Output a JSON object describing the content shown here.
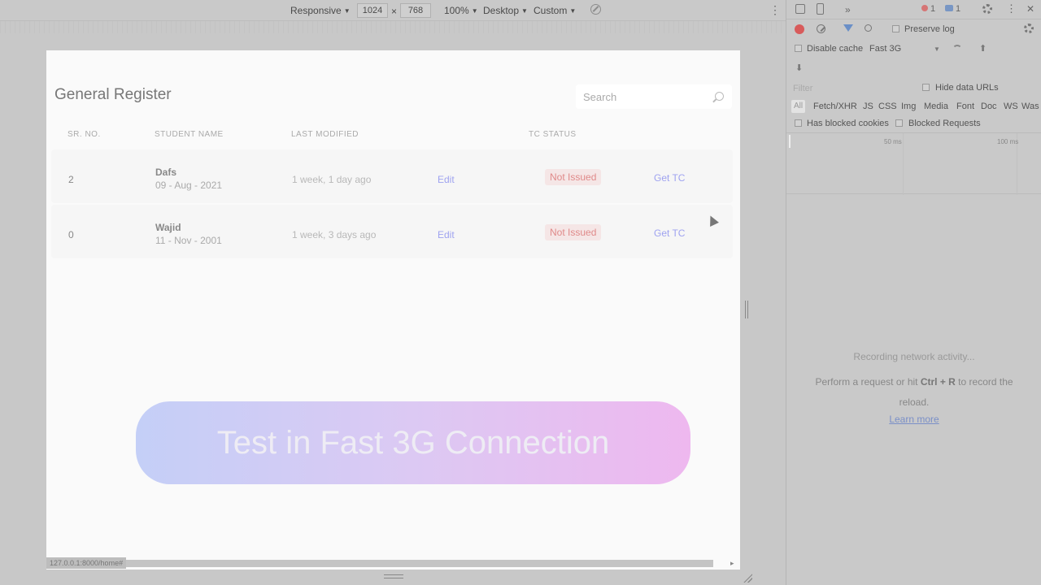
{
  "device_toolbar": {
    "dimensions": "Responsive",
    "width": "1024",
    "times": "×",
    "height": "768",
    "zoom": "100%",
    "device_type": "Desktop",
    "throttle": "Custom",
    "caret": "▼",
    "more": "⋮"
  },
  "page": {
    "title": "General Register",
    "search_placeholder": "Search",
    "columns": [
      "SR. NO.",
      "STUDENT NAME",
      "LAST MODIFIED",
      "TC STATUS"
    ],
    "rows": [
      {
        "sr": "2",
        "name": "Dafs",
        "dob": "09 - Aug - 2021",
        "modified": "1 week, 1 day ago",
        "edit": "Edit",
        "status": "Not Issued",
        "action": "Get TC"
      },
      {
        "sr": "0",
        "name": "Wajid",
        "dob": "11 - Nov - 2001",
        "modified": "1 week, 3 days ago",
        "edit": "Edit",
        "status": "Not Issued",
        "action": "Get TC"
      }
    ],
    "banner": "Test in Fast 3G Connection",
    "status_url": "127.0.0.1:8000/home#"
  },
  "devtools": {
    "more_tabs": "»",
    "error_count": "1",
    "message_count": "1",
    "close": "✕",
    "preserve_log": "Preserve log",
    "disable_cache": "Disable cache",
    "throttle": "Fast 3G",
    "import_icon": "⬆",
    "export_icon": "⬇",
    "filter_placeholder": "Filter",
    "hide_data_urls": "Hide data URLs",
    "types": [
      "All",
      "Fetch/XHR",
      "JS",
      "CSS",
      "Img",
      "Media",
      "Font",
      "Doc",
      "WS",
      "Was"
    ],
    "has_blocked_cookies": "Has blocked cookies",
    "blocked_requests": "Blocked Requests",
    "timeline_ticks": [
      "50 ms",
      "100 ms"
    ],
    "empty_line1": "Recording network activity...",
    "empty_line2_pre": "Perform a request or hit ",
    "empty_shortcut": "Ctrl + R",
    "empty_line2_post": " to record the reload.",
    "learn_more": "Learn more"
  },
  "colors": {
    "accent_link": "#9fa3f0",
    "badge_text": "#e08a8a",
    "banner_start": "#c4cff7",
    "banner_end": "#eeb8ef"
  }
}
